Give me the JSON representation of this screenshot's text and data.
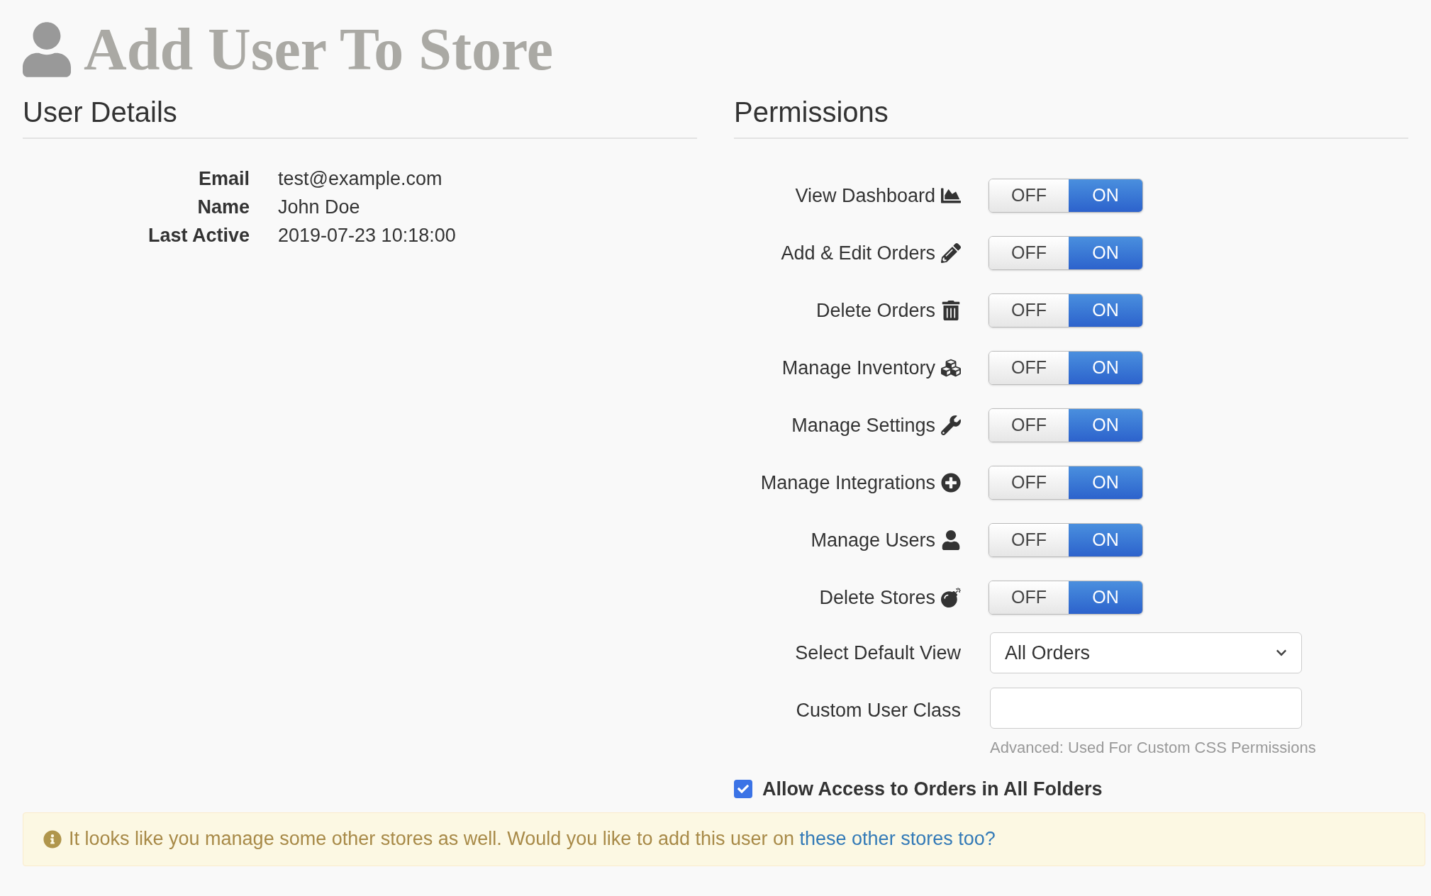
{
  "page_title": "Add User To Store",
  "user_details": {
    "heading": "User Details",
    "fields": [
      {
        "label": "Email",
        "value": "test@example.com"
      },
      {
        "label": "Name",
        "value": "John Doe"
      },
      {
        "label": "Last Active",
        "value": "2019-07-23 10:18:00"
      }
    ]
  },
  "permissions": {
    "heading": "Permissions",
    "items": [
      {
        "label": "View Dashboard",
        "off_text": "OFF",
        "on_text": "ON",
        "on": true
      },
      {
        "label": "Add & Edit Orders",
        "off_text": "OFF",
        "on_text": "ON",
        "on": true
      },
      {
        "label": "Delete Orders",
        "off_text": "OFF",
        "on_text": "ON",
        "on": true
      },
      {
        "label": "Manage Inventory",
        "off_text": "OFF",
        "on_text": "ON",
        "on": true
      },
      {
        "label": "Manage Settings",
        "off_text": "OFF",
        "on_text": "ON",
        "on": true
      },
      {
        "label": "Manage Integrations",
        "off_text": "OFF",
        "on_text": "ON",
        "on": true
      },
      {
        "label": "Manage Users",
        "off_text": "OFF",
        "on_text": "ON",
        "on": true
      },
      {
        "label": "Delete Stores",
        "off_text": "OFF",
        "on_text": "ON",
        "on": true
      }
    ],
    "default_view": {
      "label": "Select Default View",
      "value": "All Orders"
    },
    "custom_user_class": {
      "label": "Custom User Class",
      "help": "Advanced: Used For Custom CSS Permissions"
    },
    "all_folders": {
      "label": "Allow Access to Orders in All Folders",
      "checked": true
    }
  },
  "notice": {
    "text": "It looks like you manage some other stores as well. Would you like to add this user on ",
    "link": "these other stores too?"
  }
}
